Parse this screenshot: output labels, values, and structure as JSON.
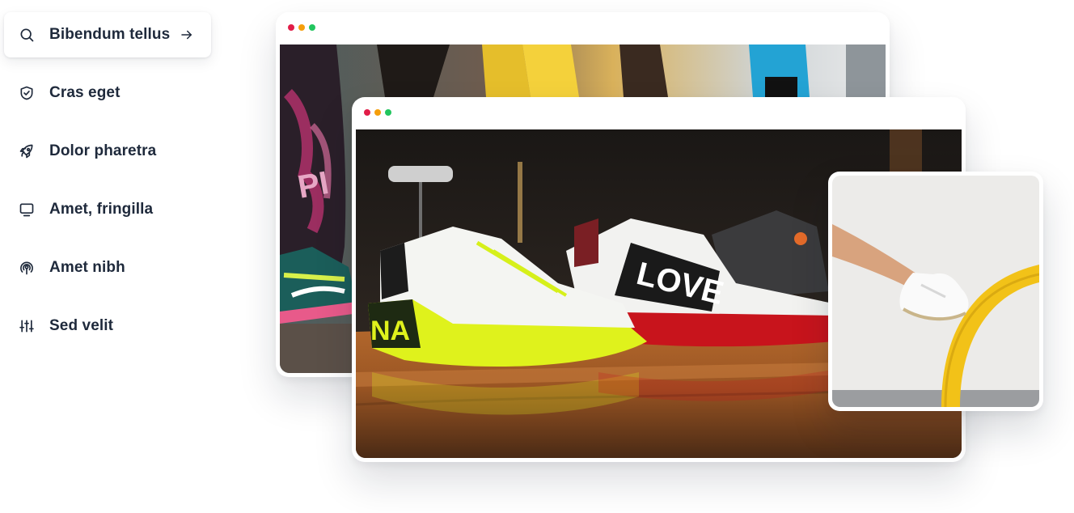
{
  "sidebar": {
    "items": [
      {
        "label": "Bibendum tellus",
        "icon": "search-icon",
        "active": true
      },
      {
        "label": "Cras eget",
        "icon": "shield-check-icon"
      },
      {
        "label": "Dolor pharetra",
        "icon": "rocket-icon"
      },
      {
        "label": "Amet, fringilla",
        "icon": "monitor-icon"
      },
      {
        "label": "Amet nibh",
        "icon": "podcast-icon"
      },
      {
        "label": "Sed velit",
        "icon": "sliders-icon"
      }
    ],
    "active_indicator_icon": "arrow-right-icon"
  },
  "windows": [
    {
      "name": "back-window",
      "content": "photo-runners-legs"
    },
    {
      "name": "front-window",
      "content": "photo-sneakers-on-table"
    }
  ],
  "card": {
    "content": "photo-foot-on-yellow-rail"
  },
  "window_controls": {
    "close": "#e11d48",
    "minimize": "#f59e0b",
    "maximize": "#22c55e"
  }
}
